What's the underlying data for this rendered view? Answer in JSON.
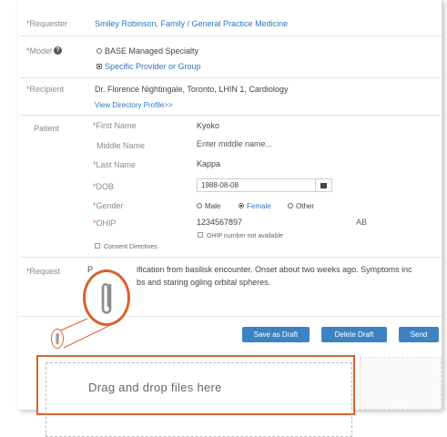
{
  "requester": {
    "label": "Requester",
    "value": "Smiley Robinson, Family / General Practice Medicine"
  },
  "model": {
    "label": "Model",
    "help_icon": "question-circle-icon",
    "options": [
      {
        "label": "BASE Managed Specialty",
        "selected": false
      },
      {
        "label": "Specific Provider or Group",
        "selected": true
      }
    ]
  },
  "recipient": {
    "label": "Recipient",
    "value": "Dr. Florence Nightingale, Toronto, LHIN 1, Cardiology",
    "profile_link": "View Directory Profile>>"
  },
  "patient": {
    "section_label": "Patient",
    "first_name": {
      "label": "First Name",
      "value": "Kyoko"
    },
    "middle_name": {
      "label": "Middle Name",
      "placeholder": "Enter middle name..."
    },
    "last_name": {
      "label": "Last Name",
      "value": "Kappa"
    },
    "dob": {
      "label": "DOB",
      "value": "1988-08-08",
      "icon": "calendar-icon"
    },
    "gender": {
      "label": "Gender",
      "options": [
        {
          "label": "Male",
          "selected": false
        },
        {
          "label": "Female",
          "selected": true
        },
        {
          "label": "Other",
          "selected": false
        }
      ]
    },
    "ohip": {
      "label": "OHIP",
      "value": "1234567897",
      "suffix": "AB",
      "not_available_label": "OHIP number not available"
    },
    "consent_label": "Consent Directives"
  },
  "request": {
    "label": "Request",
    "line1_prefix": "P",
    "line1": "ification from basilisk encounter. Onset about two weeks ago. Symptoms inc",
    "line2": "bs and staring ogling orbital spheres."
  },
  "attachment": {
    "icon": "paperclip-icon"
  },
  "buttons": {
    "save_draft": "Save as Draft",
    "delete_draft": "Delete Draft",
    "send": "Send"
  },
  "dropzone": {
    "text": "Drag and drop files here"
  },
  "colors": {
    "accent": "#2f74c0",
    "button": "#3d83c4",
    "callout": "#d9612c",
    "required": "#e06a2b"
  }
}
